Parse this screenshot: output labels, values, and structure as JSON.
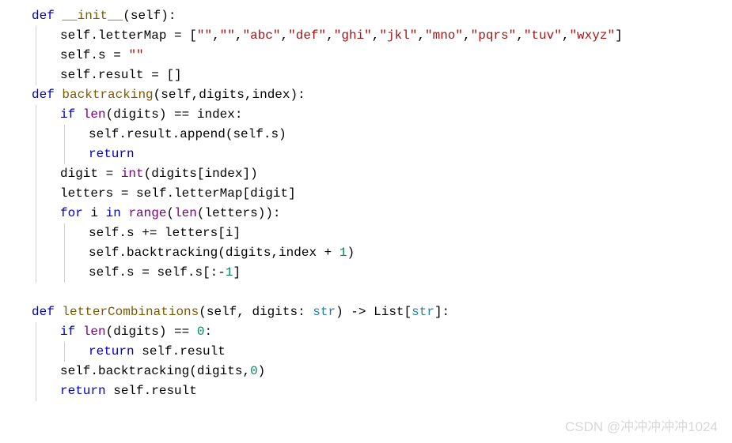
{
  "watermark": "CSDN @冲冲冲冲冲1024",
  "code": {
    "lines": [
      {
        "indent": 1,
        "tokens": [
          {
            "c": "kw",
            "t": "def"
          },
          {
            "c": "op",
            "t": " "
          },
          {
            "c": "fn",
            "t": "__init__"
          },
          {
            "c": "punct",
            "t": "("
          },
          {
            "c": "id",
            "t": "self"
          },
          {
            "c": "punct",
            "t": "):"
          }
        ]
      },
      {
        "indent": 2,
        "tokens": [
          {
            "c": "id",
            "t": "self"
          },
          {
            "c": "punct",
            "t": "."
          },
          {
            "c": "id",
            "t": "letterMap"
          },
          {
            "c": "op",
            "t": " = "
          },
          {
            "c": "punct",
            "t": "["
          },
          {
            "c": "str",
            "t": "\"\""
          },
          {
            "c": "punct",
            "t": ","
          },
          {
            "c": "str",
            "t": "\"\""
          },
          {
            "c": "punct",
            "t": ","
          },
          {
            "c": "str",
            "t": "\"abc\""
          },
          {
            "c": "punct",
            "t": ","
          },
          {
            "c": "str",
            "t": "\"def\""
          },
          {
            "c": "punct",
            "t": ","
          },
          {
            "c": "str",
            "t": "\"ghi\""
          },
          {
            "c": "punct",
            "t": ","
          },
          {
            "c": "str",
            "t": "\"jkl\""
          },
          {
            "c": "punct",
            "t": ","
          },
          {
            "c": "str",
            "t": "\"mno\""
          },
          {
            "c": "punct",
            "t": ","
          },
          {
            "c": "str",
            "t": "\"pqrs\""
          },
          {
            "c": "punct",
            "t": ","
          },
          {
            "c": "str",
            "t": "\"tuv\""
          },
          {
            "c": "punct",
            "t": ","
          },
          {
            "c": "str",
            "t": "\"wxyz\""
          },
          {
            "c": "punct",
            "t": "]"
          }
        ]
      },
      {
        "indent": 2,
        "tokens": [
          {
            "c": "id",
            "t": "self"
          },
          {
            "c": "punct",
            "t": "."
          },
          {
            "c": "id",
            "t": "s"
          },
          {
            "c": "op",
            "t": " = "
          },
          {
            "c": "str",
            "t": "\"\""
          }
        ]
      },
      {
        "indent": 2,
        "tokens": [
          {
            "c": "id",
            "t": "self"
          },
          {
            "c": "punct",
            "t": "."
          },
          {
            "c": "id",
            "t": "result"
          },
          {
            "c": "op",
            "t": " = "
          },
          {
            "c": "punct",
            "t": "[]"
          }
        ]
      },
      {
        "indent": 1,
        "tokens": [
          {
            "c": "kw",
            "t": "def"
          },
          {
            "c": "op",
            "t": " "
          },
          {
            "c": "fn",
            "t": "backtracking"
          },
          {
            "c": "punct",
            "t": "("
          },
          {
            "c": "id",
            "t": "self"
          },
          {
            "c": "punct",
            "t": ","
          },
          {
            "c": "id",
            "t": "digits"
          },
          {
            "c": "punct",
            "t": ","
          },
          {
            "c": "id",
            "t": "index"
          },
          {
            "c": "punct",
            "t": "):"
          }
        ]
      },
      {
        "indent": 2,
        "tokens": [
          {
            "c": "kw",
            "t": "if"
          },
          {
            "c": "op",
            "t": " "
          },
          {
            "c": "builtin",
            "t": "len"
          },
          {
            "c": "punct",
            "t": "("
          },
          {
            "c": "id",
            "t": "digits"
          },
          {
            "c": "punct",
            "t": ")"
          },
          {
            "c": "op",
            "t": " == "
          },
          {
            "c": "id",
            "t": "index"
          },
          {
            "c": "punct",
            "t": ":"
          }
        ]
      },
      {
        "indent": 3,
        "tokens": [
          {
            "c": "id",
            "t": "self"
          },
          {
            "c": "punct",
            "t": "."
          },
          {
            "c": "id",
            "t": "result"
          },
          {
            "c": "punct",
            "t": "."
          },
          {
            "c": "id",
            "t": "append"
          },
          {
            "c": "punct",
            "t": "("
          },
          {
            "c": "id",
            "t": "self"
          },
          {
            "c": "punct",
            "t": "."
          },
          {
            "c": "id",
            "t": "s"
          },
          {
            "c": "punct",
            "t": ")"
          }
        ]
      },
      {
        "indent": 3,
        "tokens": [
          {
            "c": "kw",
            "t": "return"
          }
        ]
      },
      {
        "indent": 2,
        "tokens": [
          {
            "c": "id",
            "t": "digit"
          },
          {
            "c": "op",
            "t": " = "
          },
          {
            "c": "builtin",
            "t": "int"
          },
          {
            "c": "punct",
            "t": "("
          },
          {
            "c": "id",
            "t": "digits"
          },
          {
            "c": "punct",
            "t": "["
          },
          {
            "c": "id",
            "t": "index"
          },
          {
            "c": "punct",
            "t": "])"
          }
        ]
      },
      {
        "indent": 2,
        "tokens": [
          {
            "c": "id",
            "t": "letters"
          },
          {
            "c": "op",
            "t": " = "
          },
          {
            "c": "id",
            "t": "self"
          },
          {
            "c": "punct",
            "t": "."
          },
          {
            "c": "id",
            "t": "letterMap"
          },
          {
            "c": "punct",
            "t": "["
          },
          {
            "c": "id",
            "t": "digit"
          },
          {
            "c": "punct",
            "t": "]"
          }
        ]
      },
      {
        "indent": 2,
        "tokens": [
          {
            "c": "kw",
            "t": "for"
          },
          {
            "c": "op",
            "t": " "
          },
          {
            "c": "id",
            "t": "i"
          },
          {
            "c": "op",
            "t": " "
          },
          {
            "c": "kw",
            "t": "in"
          },
          {
            "c": "op",
            "t": " "
          },
          {
            "c": "builtin",
            "t": "range"
          },
          {
            "c": "punct",
            "t": "("
          },
          {
            "c": "builtin",
            "t": "len"
          },
          {
            "c": "punct",
            "t": "("
          },
          {
            "c": "id",
            "t": "letters"
          },
          {
            "c": "punct",
            "t": ")):"
          }
        ]
      },
      {
        "indent": 3,
        "tokens": [
          {
            "c": "id",
            "t": "self"
          },
          {
            "c": "punct",
            "t": "."
          },
          {
            "c": "id",
            "t": "s"
          },
          {
            "c": "op",
            "t": " += "
          },
          {
            "c": "id",
            "t": "letters"
          },
          {
            "c": "punct",
            "t": "["
          },
          {
            "c": "id",
            "t": "i"
          },
          {
            "c": "punct",
            "t": "]"
          }
        ]
      },
      {
        "indent": 3,
        "tokens": [
          {
            "c": "id",
            "t": "self"
          },
          {
            "c": "punct",
            "t": "."
          },
          {
            "c": "id",
            "t": "backtracking"
          },
          {
            "c": "punct",
            "t": "("
          },
          {
            "c": "id",
            "t": "digits"
          },
          {
            "c": "punct",
            "t": ","
          },
          {
            "c": "id",
            "t": "index"
          },
          {
            "c": "op",
            "t": " + "
          },
          {
            "c": "num",
            "t": "1"
          },
          {
            "c": "punct",
            "t": ")"
          }
        ]
      },
      {
        "indent": 3,
        "tokens": [
          {
            "c": "id",
            "t": "self"
          },
          {
            "c": "punct",
            "t": "."
          },
          {
            "c": "id",
            "t": "s"
          },
          {
            "c": "op",
            "t": " = "
          },
          {
            "c": "id",
            "t": "self"
          },
          {
            "c": "punct",
            "t": "."
          },
          {
            "c": "id",
            "t": "s"
          },
          {
            "c": "punct",
            "t": "[:-"
          },
          {
            "c": "num",
            "t": "1"
          },
          {
            "c": "punct",
            "t": "]"
          }
        ]
      },
      {
        "indent": 0,
        "tokens": []
      },
      {
        "indent": 1,
        "tokens": [
          {
            "c": "kw",
            "t": "def"
          },
          {
            "c": "op",
            "t": " "
          },
          {
            "c": "fn",
            "t": "letterCombinations"
          },
          {
            "c": "punct",
            "t": "("
          },
          {
            "c": "id",
            "t": "self"
          },
          {
            "c": "punct",
            "t": ", "
          },
          {
            "c": "id",
            "t": "digits"
          },
          {
            "c": "punct",
            "t": ": "
          },
          {
            "c": "type",
            "t": "str"
          },
          {
            "c": "punct",
            "t": ")"
          },
          {
            "c": "op",
            "t": " -> "
          },
          {
            "c": "id",
            "t": "List"
          },
          {
            "c": "punct",
            "t": "["
          },
          {
            "c": "type",
            "t": "str"
          },
          {
            "c": "punct",
            "t": "]:"
          }
        ]
      },
      {
        "indent": 2,
        "tokens": [
          {
            "c": "kw",
            "t": "if"
          },
          {
            "c": "op",
            "t": " "
          },
          {
            "c": "builtin",
            "t": "len"
          },
          {
            "c": "punct",
            "t": "("
          },
          {
            "c": "id",
            "t": "digits"
          },
          {
            "c": "punct",
            "t": ")"
          },
          {
            "c": "op",
            "t": " == "
          },
          {
            "c": "num",
            "t": "0"
          },
          {
            "c": "punct",
            "t": ":"
          }
        ]
      },
      {
        "indent": 3,
        "tokens": [
          {
            "c": "kw",
            "t": "return"
          },
          {
            "c": "op",
            "t": " "
          },
          {
            "c": "id",
            "t": "self"
          },
          {
            "c": "punct",
            "t": "."
          },
          {
            "c": "id",
            "t": "result"
          }
        ]
      },
      {
        "indent": 2,
        "tokens": [
          {
            "c": "id",
            "t": "self"
          },
          {
            "c": "punct",
            "t": "."
          },
          {
            "c": "id",
            "t": "backtracking"
          },
          {
            "c": "punct",
            "t": "("
          },
          {
            "c": "id",
            "t": "digits"
          },
          {
            "c": "punct",
            "t": ","
          },
          {
            "c": "num",
            "t": "0"
          },
          {
            "c": "punct",
            "t": ")"
          }
        ]
      },
      {
        "indent": 2,
        "tokens": [
          {
            "c": "kw",
            "t": "return"
          },
          {
            "c": "op",
            "t": " "
          },
          {
            "c": "id",
            "t": "self"
          },
          {
            "c": "punct",
            "t": "."
          },
          {
            "c": "id",
            "t": "result"
          }
        ]
      }
    ]
  }
}
